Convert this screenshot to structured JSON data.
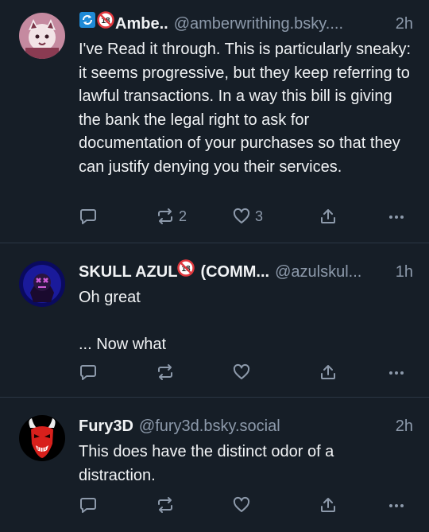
{
  "posts": [
    {
      "display_name": "Ambe..",
      "handle": "@amberwrithing.bsky....",
      "time": "2h",
      "text": "I've Read it through. This is particularly sneaky: it seems progressive, but they keep referring to lawful transactions. In a way this bill is giving the bank the legal right to ask for documentation of your purchases so that they can justify denying you their services.",
      "reply_count": "",
      "repost_count": "2",
      "like_count": "3"
    },
    {
      "display_name": "SKULL AZUL",
      "display_name_suffix": "(COMM...",
      "handle": "@azulskul...",
      "time": "1h",
      "text": "Oh  great\n\n... Now what",
      "reply_count": "",
      "repost_count": "",
      "like_count": ""
    },
    {
      "display_name": "Fury3D",
      "handle": "@fury3d.bsky.social",
      "time": "2h",
      "text": "This does have the distinct odor of a distraction.",
      "reply_count": "",
      "repost_count": "",
      "like_count": ""
    }
  ],
  "colors": {
    "background": "#161e27",
    "divider": "#2a3644",
    "text": "#f1f3f5",
    "muted": "#8d9aab",
    "badge_blue": "#1f8ad6",
    "badge_red": "#e0383e"
  },
  "icons": [
    "reply-icon",
    "repost-icon",
    "like-icon",
    "share-icon",
    "more-icon",
    "no-under-18-badge-icon",
    "refresh-badge-icon"
  ]
}
